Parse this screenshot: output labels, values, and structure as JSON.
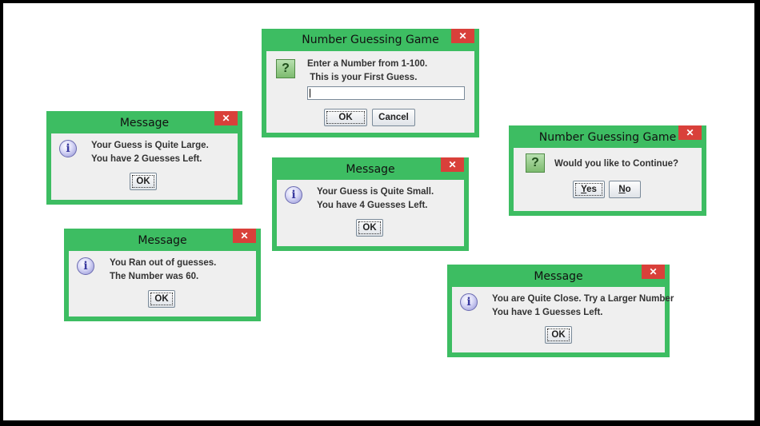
{
  "dialogs": {
    "game_enter": {
      "title": "Number Guessing Game",
      "line1": "Enter a Number from 1-100.",
      "line2": " This is your First Guess.",
      "input_value": "",
      "ok": "OK",
      "cancel": "Cancel"
    },
    "large": {
      "title": "Message",
      "line1": "Your Guess is Quite Large.",
      "line2": "You have 2 Guesses Left.",
      "ok": "OK"
    },
    "small": {
      "title": "Message",
      "line1": "Your Guess is Quite Small.",
      "line2": "You have 4 Guesses Left.",
      "ok": "OK"
    },
    "continue": {
      "title": "Number Guessing Game",
      "question": "Would you like to Continue?",
      "yes_prefix": "",
      "yes_mnemonic": "Y",
      "yes_rest": "es",
      "no_mnemonic": "N",
      "no_rest": "o"
    },
    "out": {
      "title": "Message",
      "line1": "You Ran out of guesses.",
      "line2": "The Number was 60.",
      "ok": "OK"
    },
    "close": {
      "title": "Message",
      "line1": "You are Quite Close. Try a Larger Number",
      "line2": "You have 1 Guesses Left.",
      "ok": "OK"
    }
  },
  "icons": {
    "close": "✕",
    "info": "i",
    "question": "?"
  },
  "colors": {
    "frame": "#3dbd62",
    "close_button": "#d9403a",
    "body": "#efefef"
  }
}
